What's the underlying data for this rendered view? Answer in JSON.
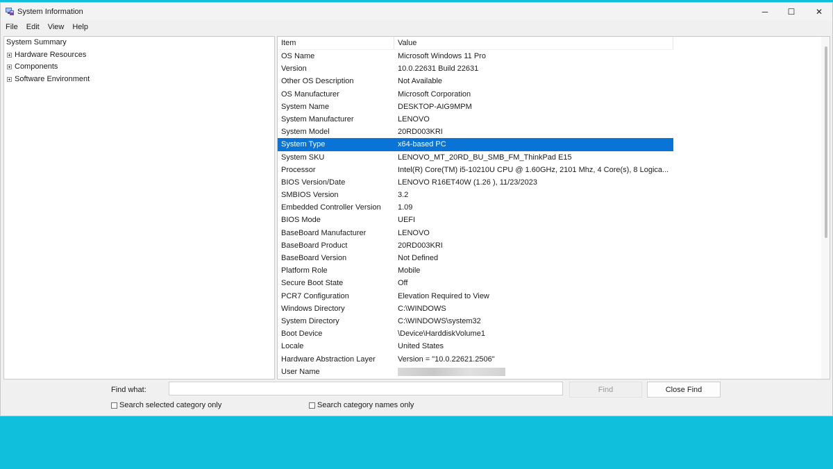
{
  "window": {
    "title": "System Information",
    "icon": "system-information-icon",
    "controls": {
      "minimize": "─",
      "maximize": "☐",
      "close": "✕"
    }
  },
  "menu": [
    "File",
    "Edit",
    "View",
    "Help"
  ],
  "tree": {
    "root": "System Summary",
    "children": [
      "Hardware Resources",
      "Components",
      "Software Environment"
    ]
  },
  "list": {
    "headers": {
      "item": "Item",
      "value": "Value"
    },
    "selected_index": 7,
    "rows": [
      {
        "item": "OS Name",
        "value": "Microsoft Windows 11 Pro"
      },
      {
        "item": "Version",
        "value": "10.0.22631 Build 22631"
      },
      {
        "item": "Other OS Description",
        "value": "Not Available"
      },
      {
        "item": "OS Manufacturer",
        "value": "Microsoft Corporation"
      },
      {
        "item": "System Name",
        "value": "DESKTOP-AIG9MPM"
      },
      {
        "item": "System Manufacturer",
        "value": "LENOVO"
      },
      {
        "item": "System Model",
        "value": "20RD003KRI"
      },
      {
        "item": "System Type",
        "value": "x64-based PC"
      },
      {
        "item": "System SKU",
        "value": "LENOVO_MT_20RD_BU_SMB_FM_ThinkPad E15"
      },
      {
        "item": "Processor",
        "value": "Intel(R) Core(TM) i5-10210U CPU @ 1.60GHz, 2101 Mhz, 4 Core(s), 8 Logica..."
      },
      {
        "item": "BIOS Version/Date",
        "value": "LENOVO R16ET40W (1.26 ), 11/23/2023"
      },
      {
        "item": "SMBIOS Version",
        "value": "3.2"
      },
      {
        "item": "Embedded Controller Version",
        "value": "1.09"
      },
      {
        "item": "BIOS Mode",
        "value": "UEFI"
      },
      {
        "item": "BaseBoard Manufacturer",
        "value": "LENOVO"
      },
      {
        "item": "BaseBoard Product",
        "value": "20RD003KRI"
      },
      {
        "item": "BaseBoard Version",
        "value": "Not Defined"
      },
      {
        "item": "Platform Role",
        "value": "Mobile"
      },
      {
        "item": "Secure Boot State",
        "value": "Off"
      },
      {
        "item": "PCR7 Configuration",
        "value": "Elevation Required to View"
      },
      {
        "item": "Windows Directory",
        "value": "C:\\WINDOWS"
      },
      {
        "item": "System Directory",
        "value": "C:\\WINDOWS\\system32"
      },
      {
        "item": "Boot Device",
        "value": "\\Device\\HarddiskVolume1"
      },
      {
        "item": "Locale",
        "value": "United States"
      },
      {
        "item": "Hardware Abstraction Layer",
        "value": "Version = \"10.0.22621.2506\""
      },
      {
        "item": "User Name",
        "value": ""
      }
    ]
  },
  "find": {
    "label": "Find what:",
    "value": "",
    "find_button": "Find",
    "close_button": "Close Find",
    "check_selected": "Search selected category only",
    "check_names": "Search category names only"
  },
  "colors": {
    "selection": "#0a74d6",
    "desktop": "#0fbfdb"
  }
}
